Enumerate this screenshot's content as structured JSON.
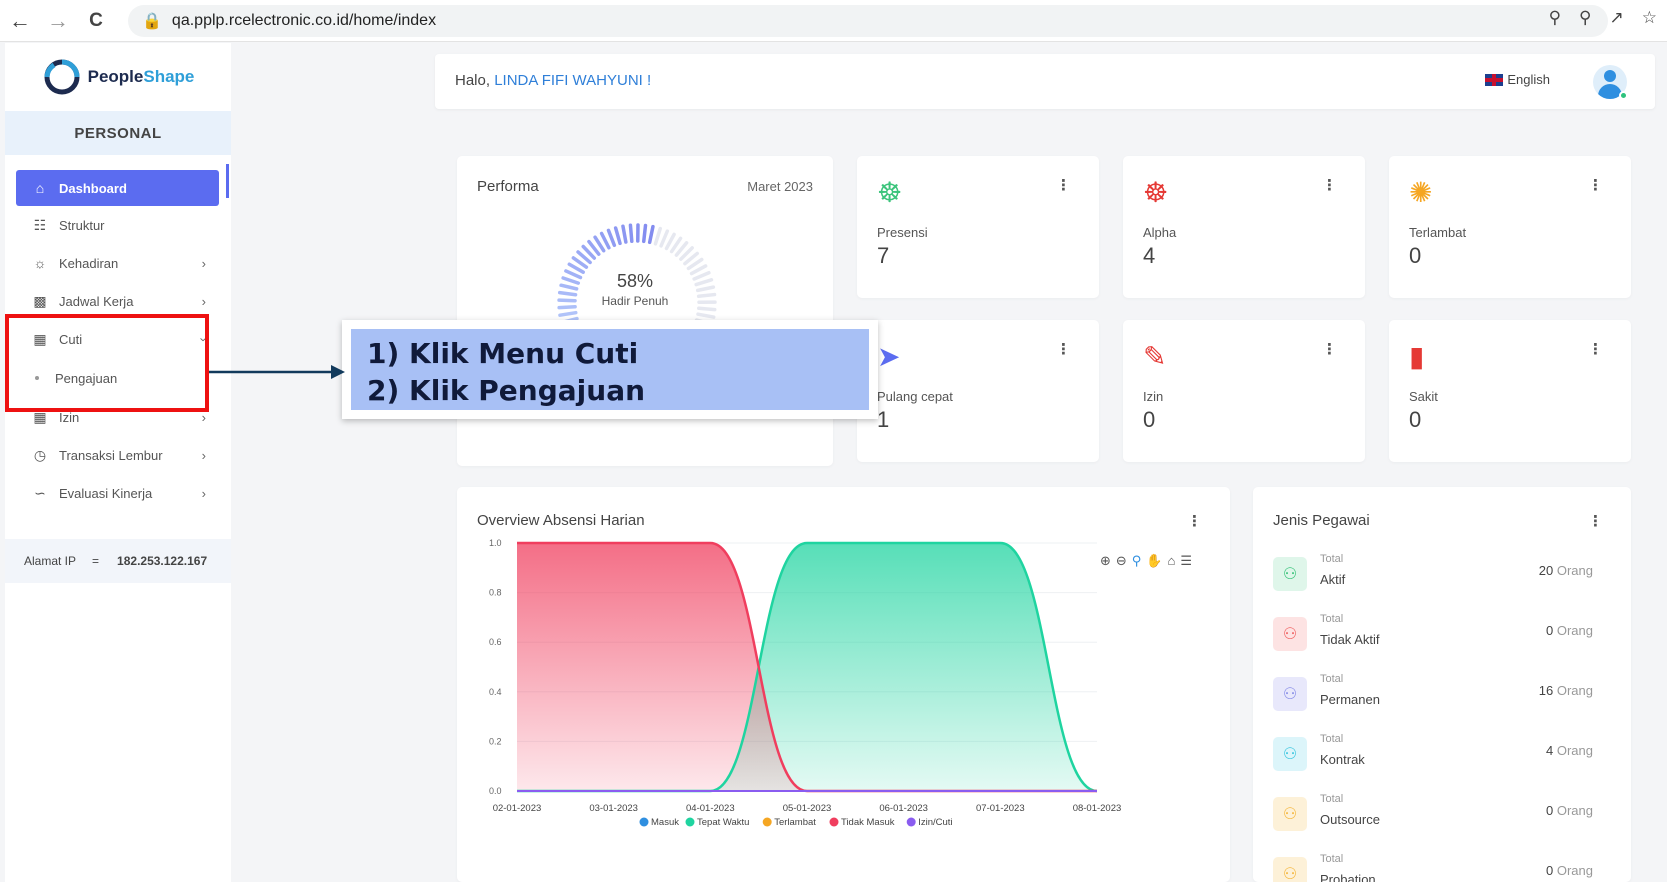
{
  "browser": {
    "back": "←",
    "forward": "→",
    "reload": "C",
    "url": "qa.pplp.rcelectronic.co.id/home/index"
  },
  "sidebar": {
    "logo_main": "People",
    "logo_accent": "Shape",
    "section": "PERSONAL",
    "items": [
      {
        "label": "Dashboard",
        "icon": "home-icon"
      },
      {
        "label": "Struktur",
        "icon": "org-chart-icon"
      },
      {
        "label": "Kehadiran",
        "icon": "fingerprint-icon"
      },
      {
        "label": "Jadwal Kerja",
        "icon": "briefcase-icon"
      },
      {
        "label": "Cuti",
        "icon": "calendar-icon"
      },
      {
        "label": "Izin",
        "icon": "calendar-icon"
      },
      {
        "label": "Transaksi Lembur",
        "icon": "clock-icon"
      },
      {
        "label": "Evaluasi Kinerja",
        "icon": "chart-line-icon"
      }
    ],
    "sub_items": [
      {
        "label": "Pengajuan"
      }
    ],
    "ip_label": "Alamat IP",
    "ip_sep": "=",
    "ip_value": "182.253.122.167"
  },
  "header": {
    "greeting_prefix": "Halo,",
    "user_name": "LINDA FIFI WAHYUNI !",
    "language": "English"
  },
  "performa": {
    "title": "Performa",
    "month": "Maret 2023",
    "percent": "58%",
    "percent_value": 58,
    "label": "Hadir Penuh"
  },
  "stats": [
    {
      "label": "Presensi",
      "value": "7",
      "color": "#3cc47c"
    },
    {
      "label": "Alpha",
      "value": "4",
      "color": "#e53935"
    },
    {
      "label": "Terlambat",
      "value": "0",
      "color": "#f5a623"
    },
    {
      "label": "Pulang cepat",
      "value": "1",
      "color": "#5b6cf0"
    },
    {
      "label": "Izin",
      "value": "0",
      "color": "#e53935"
    },
    {
      "label": "Sakit",
      "value": "0",
      "color": "#e53935"
    }
  ],
  "callout": {
    "line1": "1) Klik Menu Cuti",
    "line2": "2) Klik Pengajuan"
  },
  "overview": {
    "title": "Overview Absensi Harian"
  },
  "jenis_pegawai": {
    "title": "Jenis Pegawai",
    "total_label": "Total",
    "unit": "Orang",
    "rows": [
      {
        "name": "Aktif",
        "count": "20",
        "color": "#3cc47c",
        "bg": "#dff6ea"
      },
      {
        "name": "Tidak Aktif",
        "count": "0",
        "color": "#f06464",
        "bg": "#fde3e3"
      },
      {
        "name": "Permanen",
        "count": "16",
        "color": "#8a8fe8",
        "bg": "#e8e8fb"
      },
      {
        "name": "Kontrak",
        "count": "4",
        "color": "#3ec7e0",
        "bg": "#dcf5fa"
      },
      {
        "name": "Outsource",
        "count": "0",
        "color": "#f5b942",
        "bg": "#fdf1d8"
      },
      {
        "name": "Probation",
        "count": "0",
        "color": "#f5b942",
        "bg": "#fdf1d8"
      }
    ]
  },
  "chart_data": {
    "type": "area",
    "title": "Overview Absensi Harian",
    "x": [
      "02-01-2023",
      "03-01-2023",
      "04-01-2023",
      "05-01-2023",
      "06-01-2023",
      "07-01-2023",
      "08-01-2023"
    ],
    "y_ticks": [
      "1.0",
      "0.8",
      "0.6",
      "0.4",
      "0.2",
      "0.0"
    ],
    "ylim": [
      0,
      1
    ],
    "series": [
      {
        "name": "Masuk",
        "color": "#2f8fe0",
        "values": [
          0,
          0,
          0,
          0,
          0,
          0,
          0
        ]
      },
      {
        "name": "Tepat Waktu",
        "color": "#1fd4a0",
        "values": [
          0,
          0,
          0,
          1,
          1,
          1,
          0
        ]
      },
      {
        "name": "Terlambat",
        "color": "#f5a623",
        "values": [
          0,
          0,
          0,
          0,
          0,
          0,
          0
        ]
      },
      {
        "name": "Tidak Masuk",
        "color": "#f03e5e",
        "values": [
          1,
          1,
          1,
          0,
          0,
          0,
          0
        ]
      },
      {
        "name": "Izin/Cuti",
        "color": "#8a5cf0",
        "values": [
          0,
          0,
          0,
          0,
          0,
          0,
          0
        ]
      }
    ],
    "legend": "bottom",
    "grid": true
  }
}
